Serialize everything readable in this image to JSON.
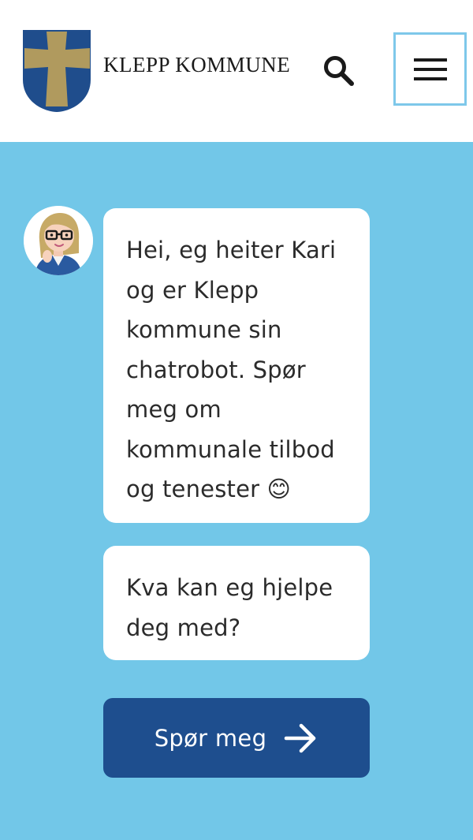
{
  "header": {
    "brand_name": "KLEPP KOMMUNE",
    "logo_icon": "klepp-crest-icon",
    "search_icon": "search-icon",
    "menu_icon": "hamburger-menu-icon"
  },
  "chat": {
    "avatar_icon": "kari-avatar-icon",
    "greeting": "Hei, eg heiter Kari og er Klepp kommune sin chatrobot. Spør meg om kommunale tilbod og tenester 😊",
    "question": "Kva kan eg hjelpe deg med?",
    "ask_button_label": "Spør meg",
    "ask_button_icon": "arrow-right-icon"
  },
  "colors": {
    "chat_background": "#72c7e8",
    "button_background": "#1e4e8e",
    "crest_blue": "#1f4d8c",
    "crest_gold": "#b09a5e",
    "menu_border": "#7ec8ea"
  }
}
